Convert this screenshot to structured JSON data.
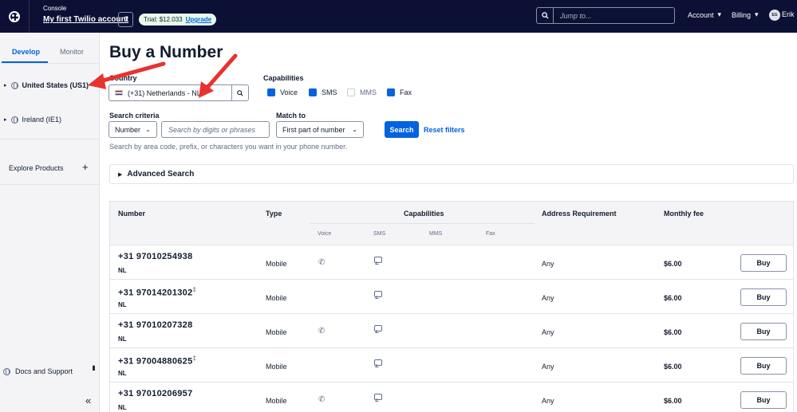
{
  "topbar": {
    "console_label": "Console",
    "account_name": "My first Twilio account",
    "trial_text": "Trial: $12.033",
    "upgrade_label": "Upgrade",
    "jump_placeholder": "Jump to...",
    "account_menu": "Account",
    "billing_menu": "Billing",
    "avatar_initials": "EG",
    "user_name": "Erik"
  },
  "sidebar": {
    "tabs": [
      {
        "label": "Develop"
      },
      {
        "label": "Monitor"
      }
    ],
    "regions": [
      {
        "label": "United States (US1)"
      },
      {
        "label": "Ireland (IE1)"
      }
    ],
    "explore_label": "Explore Products",
    "docs_label": "Docs and Support"
  },
  "main": {
    "title": "Buy a Number",
    "country_label": "Country",
    "country_value": "(+31) Netherlands - NL",
    "capabilities_label": "Capabilities",
    "capabilities": [
      {
        "label": "Voice",
        "checked": true
      },
      {
        "label": "SMS",
        "checked": true
      },
      {
        "label": "MMS",
        "checked": false
      },
      {
        "label": "Fax",
        "checked": true
      }
    ],
    "search_criteria_label": "Search criteria",
    "search_criteria_value": "Number",
    "digits_placeholder": "Search by digits or phrases",
    "match_to_label": "Match to",
    "match_to_value": "First part of number",
    "search_button": "Search",
    "reset_filters": "Reset filters",
    "helper_text": "Search by area code, prefix, or characters you want in your phone number.",
    "advanced_search": "Advanced Search"
  },
  "table": {
    "headers": {
      "number": "Number",
      "type": "Type",
      "capabilities": "Capabilities",
      "address": "Address Requirement",
      "fee": "Monthly fee"
    },
    "cap_headers": [
      "Voice",
      "SMS",
      "MMS",
      "Fax"
    ],
    "buy_label": "Buy",
    "rows": [
      {
        "number": "+31 97010254938",
        "country": "NL",
        "type": "Mobile",
        "voice": true,
        "sms": true,
        "address": "Any",
        "fee": "$6.00",
        "dagger": false
      },
      {
        "number": "+31 97014201302",
        "country": "NL",
        "type": "Mobile",
        "voice": false,
        "sms": true,
        "address": "Any",
        "fee": "$6.00",
        "dagger": true
      },
      {
        "number": "+31 97010207328",
        "country": "NL",
        "type": "Mobile",
        "voice": true,
        "sms": true,
        "address": "Any",
        "fee": "$6.00",
        "dagger": false
      },
      {
        "number": "+31 97004880625",
        "country": "NL",
        "type": "Mobile",
        "voice": false,
        "sms": true,
        "address": "Any",
        "fee": "$6.00",
        "dagger": true
      },
      {
        "number": "+31 97010206957",
        "country": "NL",
        "type": "Mobile",
        "voice": true,
        "sms": true,
        "address": "Any",
        "fee": "$6.00",
        "dagger": false
      }
    ]
  },
  "colors": {
    "topbar_bg": "#0b1034",
    "accent": "#0263e0",
    "annotation_arrow": "#e8322f"
  }
}
